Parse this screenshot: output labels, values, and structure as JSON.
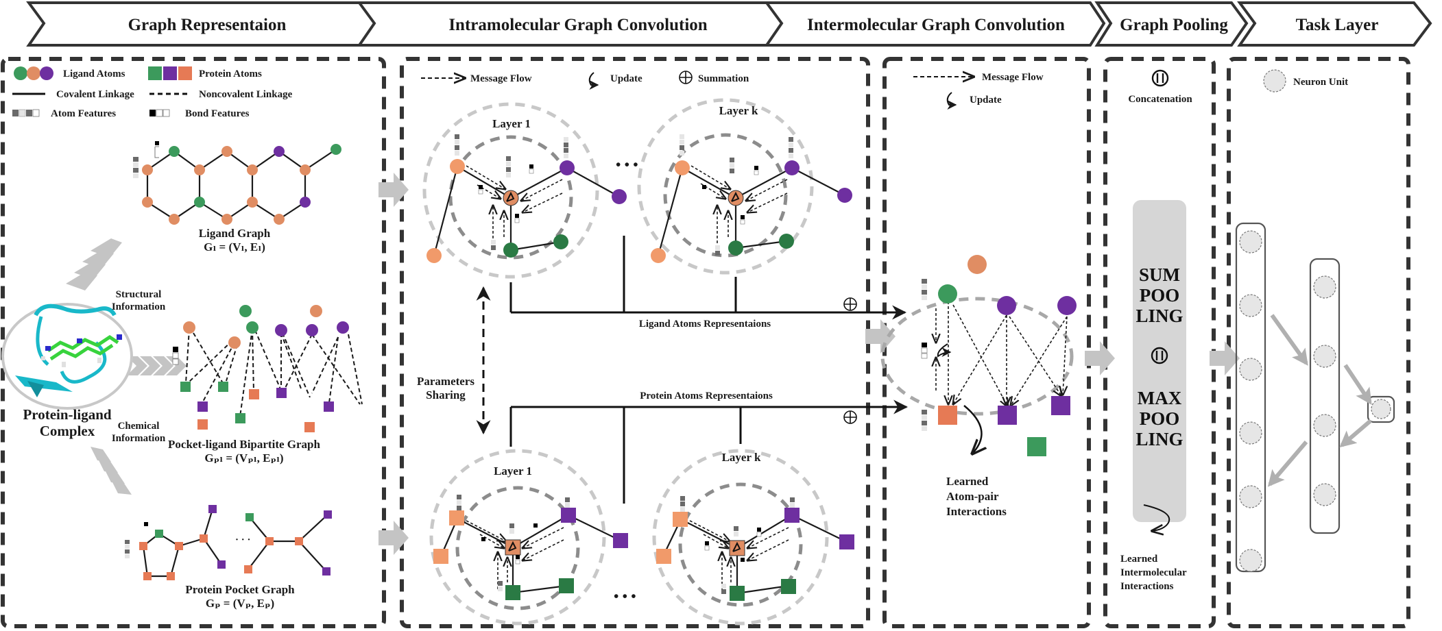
{
  "colors": {
    "green": "#3c9a5c",
    "orange": "#e08d63",
    "purple": "#6e2fa0",
    "protein_orange": "#e67a55",
    "dark_green": "#2a7a44",
    "pooling_bg": "#d6d6d6",
    "cyan": "#19b8c9"
  },
  "header": {
    "stages": [
      {
        "label": "Graph Representaion"
      },
      {
        "label": "Intramolecular Graph Convolution"
      },
      {
        "label": "Intermolecular Graph Convolution"
      },
      {
        "label": "Graph Pooling"
      },
      {
        "label": "Task Layer"
      }
    ]
  },
  "representation": {
    "legend": {
      "ligand_atoms": "Ligand Atoms",
      "protein_atoms": "Protein Atoms",
      "covalent": "Covalent Linkage",
      "noncovalent": "Noncovalent Linkage",
      "atom_features": "Atom Features",
      "bond_features": "Bond Features"
    },
    "ligand_graph": {
      "title": "Ligand Graph",
      "formula": "Gₗ = (Vₗ, Eₗ)"
    },
    "complex": {
      "line1": "Protein-ligand",
      "line2": "Complex"
    },
    "structural_info": {
      "line1": "Structural",
      "line2": "Information"
    },
    "chemical_info": {
      "line1": "Chemical",
      "line2": "Information"
    },
    "bipartite_graph": {
      "title": "Pocket-ligand Bipartite Graph",
      "formula": "Gₚₗ = (Vₚₗ, Eₚₗ)"
    },
    "pocket_graph": {
      "title": "Protein Pocket Graph",
      "formula": "Gₚ = (Vₚ, Eₚ)",
      "ellipsis": "· · ·"
    }
  },
  "intramolecular": {
    "legend": {
      "message_flow": "Message  Flow",
      "update": "Update",
      "summation": "Summation"
    },
    "layer_first": "Layer 1",
    "layer_last": "Layer k",
    "ellipsis": "• • •",
    "parameters_sharing": {
      "line1": "Parameters",
      "line2": "Sharing"
    },
    "ligand_repr": "Ligand Atoms Representaions",
    "protein_repr": "Protein Atoms Representaions"
  },
  "intermolecular": {
    "legend": {
      "message_flow": "Message  Flow",
      "update": "Update"
    },
    "learned": {
      "line1": "Learned",
      "line2": "Atom-pair",
      "line3": "Interactions"
    }
  },
  "pooling": {
    "concatenation": "Concatenation",
    "sum": [
      "SUM",
      "POO",
      "LING"
    ],
    "max": [
      "MAX",
      "POO",
      "LING"
    ],
    "learned": {
      "line1": "Learned",
      "line2": "Intermolecular",
      "line3": "Interactions"
    }
  },
  "task": {
    "neuron_unit": "Neuron Unit",
    "layer_sizes": [
      6,
      4,
      1
    ]
  }
}
